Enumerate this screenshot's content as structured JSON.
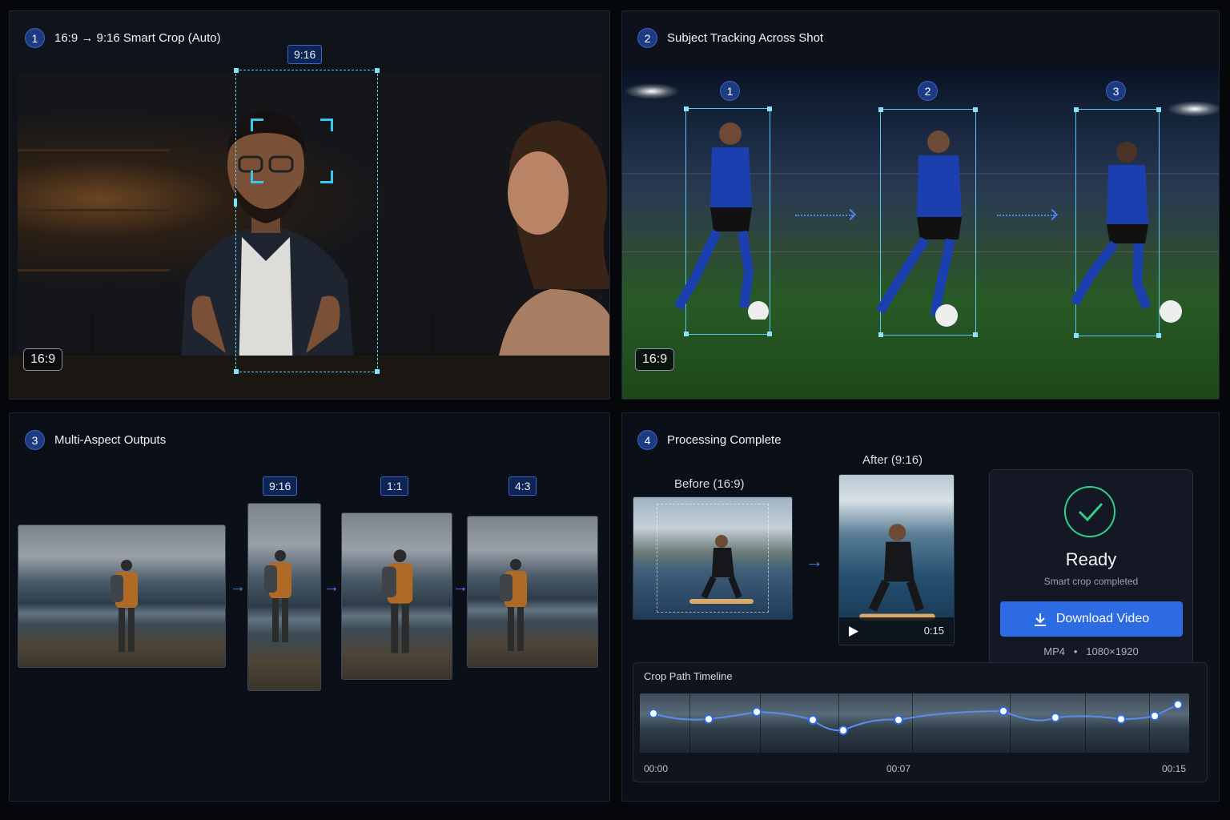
{
  "panels": {
    "p1": {
      "num": "1",
      "title": "16:9 → 9:16 Smart Crop (Auto)",
      "crop_tag": "9:16",
      "source_badge": "16:9"
    },
    "p2": {
      "num": "2",
      "title": "Subject Tracking Across Shot",
      "markers": [
        "1",
        "2",
        "3"
      ],
      "source_badge": "16:9"
    },
    "p3": {
      "num": "3",
      "title": "Multi-Aspect Outputs",
      "outputs": [
        "9:16",
        "1:1",
        "4:3"
      ]
    },
    "p4": {
      "num": "4",
      "title": "Processing Complete",
      "before_label": "Before (16:9)",
      "after_label": "After (9:16)",
      "duration": "0:15",
      "ready": {
        "title": "Ready",
        "subtitle": "Smart crop completed",
        "button": "Download Video",
        "format": "MP4",
        "separator": "•",
        "resolution": "1080×1920"
      },
      "timeline": {
        "label": "Crop Path Timeline",
        "ticks": [
          "00:00",
          "00:07",
          "00:15"
        ]
      }
    }
  },
  "colors": {
    "accent": "#2c6be3",
    "tracking": "#56c9ef",
    "success": "#2fcf8c",
    "badge_bg": "#0e2454"
  },
  "icons": {
    "play": "play-icon",
    "download": "download-icon",
    "check": "check-icon",
    "arrow": "arrow-right-icon"
  }
}
